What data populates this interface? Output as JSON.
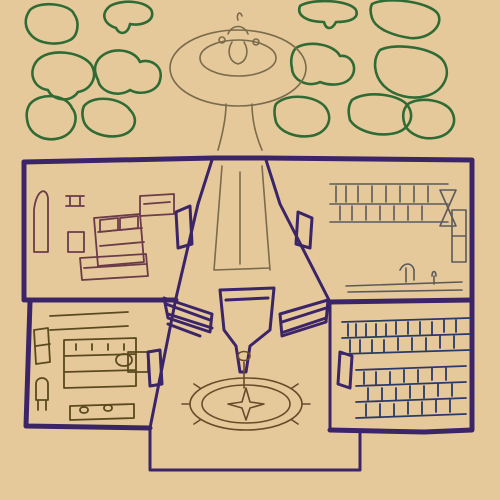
{
  "scene": {
    "kind": "hand-drawn top-down house map",
    "colors": {
      "background": "#e6c99b",
      "trees": "#2f6b34",
      "walls": "#3b2568",
      "bedroom": "#6b3b4a",
      "kitchen": "#5a4a1e",
      "workshop": "#5a5a5a",
      "library": "#2a3a66",
      "fountain": "#7a6b4c"
    }
  },
  "areas": [
    {
      "id": "garden",
      "icon": "tree-icon"
    },
    {
      "id": "fountain",
      "icon": "fountain-icon"
    },
    {
      "id": "bedroom",
      "icon": "bed-icon"
    },
    {
      "id": "workshop",
      "icon": "shelf-icon"
    },
    {
      "id": "kitchen",
      "icon": "stove-icon"
    },
    {
      "id": "library",
      "icon": "bookshelf-icon"
    },
    {
      "id": "great-hall",
      "icon": "throne-icon"
    }
  ]
}
